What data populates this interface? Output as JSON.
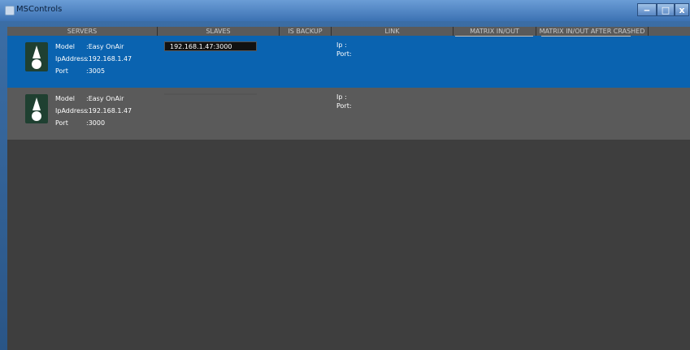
{
  "window": {
    "title": "MSControls"
  },
  "header": {
    "columns": [
      "SERVERS",
      "SLAVES",
      "IS BACKUP",
      "LINK",
      "MATRIX IN/OUT",
      "MATRIX IN/OUT AFTER CRASHED"
    ]
  },
  "rows": [
    {
      "model_label": "Model",
      "model_value": ":Easy OnAir",
      "ip_label": "IpAddress",
      "ip_value": ":192.168.1.47",
      "port_label": "Port",
      "port_value": ":3005",
      "slave": "192.168.1.47:3000",
      "link_ip": "Ip  :",
      "link_port": "Port:"
    },
    {
      "model_label": "Model",
      "model_value": ":Easy OnAir",
      "ip_label": "IpAddress",
      "ip_value": ":192.168.1.47",
      "port_label": "Port",
      "port_value": ":3000",
      "slave": "",
      "link_ip": "Ip  :",
      "link_port": "Port:"
    }
  ]
}
